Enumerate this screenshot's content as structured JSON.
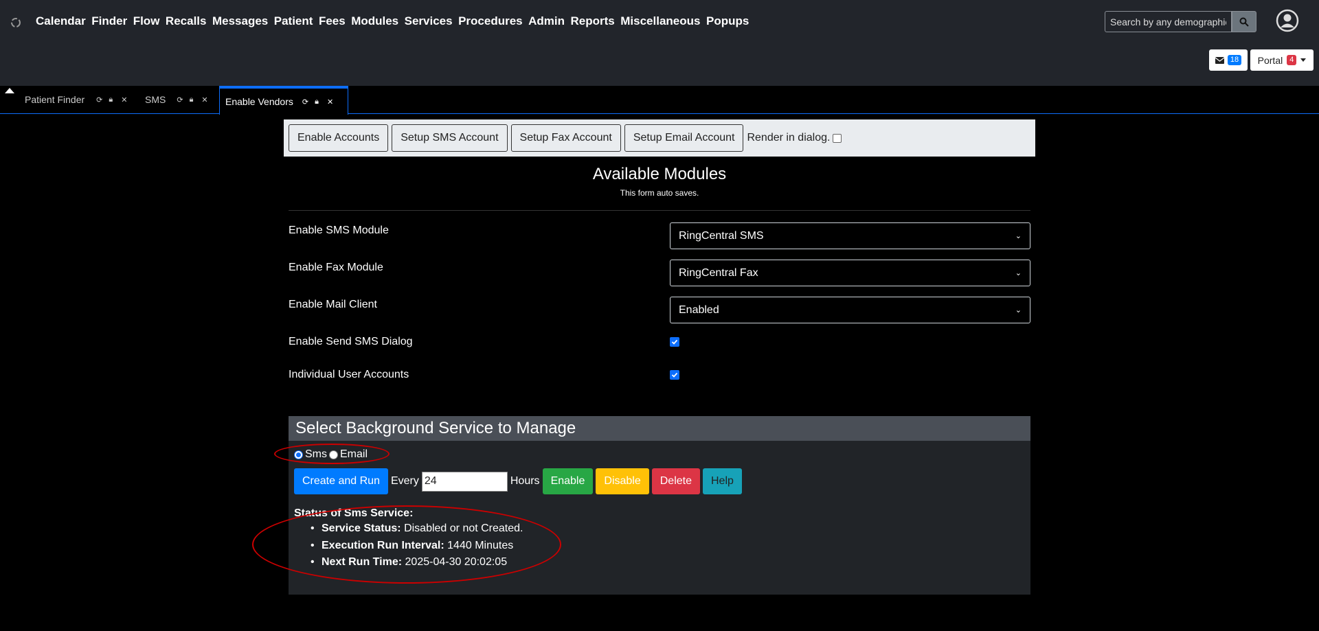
{
  "nav": {
    "menu": [
      "Calendar",
      "Finder",
      "Flow",
      "Recalls",
      "Messages",
      "Patient",
      "Fees",
      "Modules",
      "Services",
      "Procedures",
      "Admin",
      "Reports",
      "Miscellaneous",
      "Popups"
    ],
    "search_placeholder": "Search by any demographics",
    "messages_count": "18",
    "portal_label": "Portal",
    "portal_count": "4"
  },
  "tabs": [
    {
      "label": "Patient Finder",
      "active": false
    },
    {
      "label": "SMS",
      "active": false
    },
    {
      "label": "Enable Vendors",
      "active": true
    }
  ],
  "toolbar": {
    "enable_accounts": "Enable Accounts",
    "setup_sms": "Setup SMS Account",
    "setup_fax": "Setup Fax Account",
    "setup_email": "Setup Email Account",
    "render_dialog": "Render in dialog."
  },
  "modules": {
    "title": "Available Modules",
    "subtitle": "This form auto saves.",
    "sms_label": "Enable SMS Module",
    "sms_value": "RingCentral SMS",
    "fax_label": "Enable Fax Module",
    "fax_value": "RingCentral Fax",
    "mail_label": "Enable Mail Client",
    "mail_value": "Enabled",
    "send_sms_label": "Enable Send SMS Dialog",
    "send_sms_checked": true,
    "individual_label": "Individual User Accounts",
    "individual_checked": true
  },
  "service": {
    "heading": "Select Background Service to Manage",
    "radio_sms": "Sms",
    "radio_email": "Email",
    "selected": "Sms",
    "create_run": "Create and Run",
    "every_label": "Every",
    "every_value": "24",
    "hours_label": "Hours",
    "enable": "Enable",
    "disable": "Disable",
    "delete": "Delete",
    "help": "Help",
    "status_title": "Status of Sms Service:",
    "status_label": "Service Status:",
    "status_value": "Disabled or not Created.",
    "interval_label": "Execution Run Interval:",
    "interval_value": "1440 Minutes",
    "next_label": "Next Run Time:",
    "next_value": "2025-04-30 20:02:05"
  },
  "colors": {
    "accent": "#0d6efd",
    "annotation": "#cc0000"
  }
}
